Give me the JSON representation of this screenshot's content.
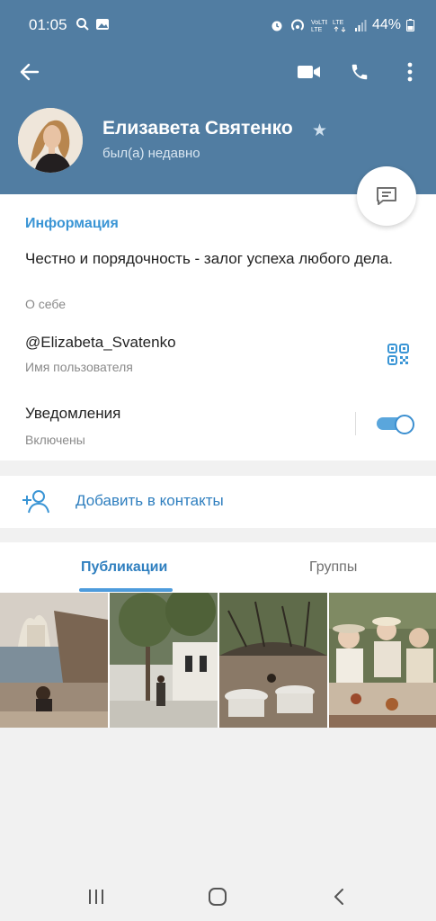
{
  "status_bar": {
    "time": "01:05",
    "battery": "44%"
  },
  "appbar": {
    "back_icon": "arrow-left-icon",
    "video_icon": "video-camera-icon",
    "call_icon": "phone-icon",
    "menu_icon": "more-vertical-icon"
  },
  "profile": {
    "name": "Елизавета Святенко",
    "status": "был(а) недавно",
    "badge_icon": "star-icon"
  },
  "info": {
    "section_title": "Информация",
    "bio": "Честно и порядочность - залог успеха любого дела.",
    "bio_label": "О себе",
    "username": "@Elizabeta_Svatenko",
    "username_label": "Имя пользователя",
    "notifications_label": "Уведомления",
    "notifications_status": "Включены",
    "notifications_enabled": true
  },
  "actions": {
    "add_contact": "Добавить в контакты"
  },
  "tabs": [
    {
      "label": "Публикации",
      "active": true
    },
    {
      "label": "Группы",
      "active": false
    }
  ],
  "colors": {
    "header": "#517da2",
    "accent": "#3a95d5",
    "link": "#2f7fbf"
  }
}
